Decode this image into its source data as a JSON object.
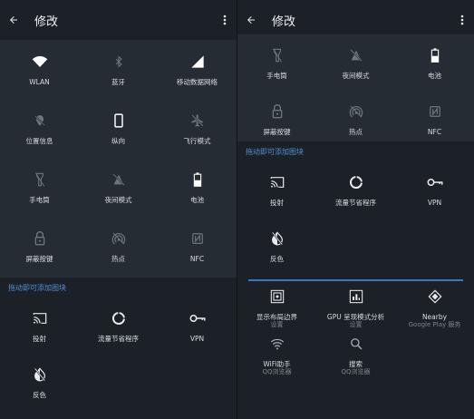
{
  "screen_left": {
    "title": "修改",
    "active_tiles": [
      {
        "label": "WLAN",
        "icon": "wifi-icon"
      },
      {
        "label": "蓝牙",
        "icon": "bluetooth-icon"
      },
      {
        "label": "移动数据网络",
        "icon": "signal-icon"
      },
      {
        "label": "位置信息",
        "icon": "location-off-icon"
      },
      {
        "label": "纵向",
        "icon": "phone-portrait-icon"
      },
      {
        "label": "飞行模式",
        "icon": "airplane-off-icon"
      },
      {
        "label": "手电筒",
        "icon": "flashlight-icon"
      },
      {
        "label": "夜间模式",
        "icon": "night-mode-icon"
      },
      {
        "label": "电池",
        "icon": "battery-icon"
      },
      {
        "label": "屏蔽按键",
        "icon": "lock-icon"
      },
      {
        "label": "热点",
        "icon": "hotspot-icon"
      },
      {
        "label": "NFC",
        "icon": "nfc-icon"
      }
    ],
    "section_label": "拖动即可添加图块",
    "available_tiles": [
      {
        "label": "投射",
        "icon": "cast-icon"
      },
      {
        "label": "流量节省程序",
        "icon": "data-saver-icon"
      },
      {
        "label": "VPN",
        "icon": "vpn-key-icon"
      },
      {
        "label": "反色",
        "icon": "invert-colors-icon"
      }
    ]
  },
  "screen_right": {
    "title": "修改",
    "active_tiles_partial": [
      {
        "label": "手电筒",
        "icon": "flashlight-icon"
      },
      {
        "label": "夜间模式",
        "icon": "night-mode-icon"
      },
      {
        "label": "电池",
        "icon": "battery-icon"
      },
      {
        "label": "屏蔽按键",
        "icon": "lock-icon"
      },
      {
        "label": "热点",
        "icon": "hotspot-icon"
      },
      {
        "label": "NFC",
        "icon": "nfc-icon"
      }
    ],
    "section_label": "拖动即可添加图块",
    "system_tiles": [
      {
        "label": "投射",
        "icon": "cast-icon"
      },
      {
        "label": "流量节省程序",
        "icon": "data-saver-icon"
      },
      {
        "label": "VPN",
        "icon": "vpn-key-icon"
      },
      {
        "label": "反色",
        "icon": "invert-colors-icon"
      }
    ],
    "third_party_tiles": [
      {
        "label": "显示布局边界",
        "sub": "设置",
        "icon": "layout-bounds-icon"
      },
      {
        "label": "GPU 呈现模式分析",
        "sub": "设置",
        "icon": "gpu-profile-icon"
      },
      {
        "label": "Nearby",
        "sub": "Google Play 服务",
        "icon": "nearby-icon"
      },
      {
        "label": "WiFi助手",
        "sub": "QQ浏览器",
        "icon": "wifi-assistant-icon"
      },
      {
        "label": "搜索",
        "sub": "QQ浏览器",
        "icon": "search-icon"
      }
    ]
  },
  "colors": {
    "background": "#1c2127",
    "tile_area": "#262c33",
    "accent": "#4f8fd6",
    "text": "#e8eaed",
    "sub_text": "#7d848b"
  }
}
